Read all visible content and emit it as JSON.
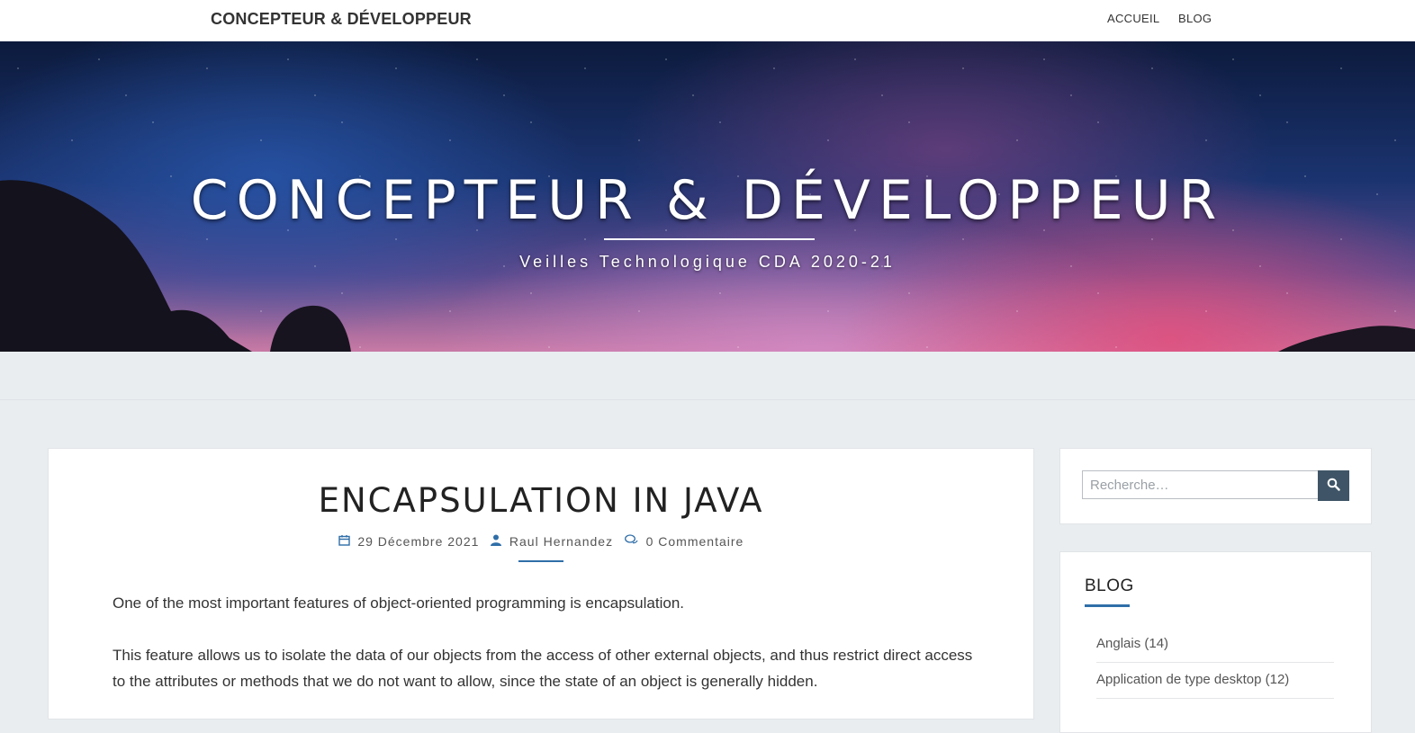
{
  "header": {
    "brand": "CONCEPTEUR & DÉVELOPPEUR",
    "nav": [
      {
        "label": "ACCUEIL"
      },
      {
        "label": "BLOG"
      }
    ]
  },
  "hero": {
    "title": "CONCEPTEUR & DÉVELOPPEUR",
    "subtitle": "Veilles Technologique CDA 2020-21"
  },
  "post": {
    "title": "ENCAPSULATION IN JAVA",
    "date": "29 Décembre 2021",
    "author": "Raul Hernandez",
    "comments": "0 Commentaire",
    "paragraphs": [
      "One of the most important features of object-oriented programming is encapsulation.",
      "This feature allows us to isolate the data of our objects from the access of other external objects, and thus restrict direct access to the attributes or methods that we do not want to allow, since the state of an object is generally hidden."
    ]
  },
  "sidebar": {
    "search": {
      "placeholder": "Recherche…"
    },
    "blog": {
      "title": "BLOG",
      "categories": [
        {
          "label": "Anglais (14)"
        },
        {
          "label": "Application de type desktop (12)"
        }
      ]
    }
  },
  "icons": {
    "date": "calendar-icon",
    "author": "user-icon",
    "comments": "comments-icon",
    "search": "search-icon"
  },
  "colors": {
    "accent": "#2f6ea8",
    "search_button": "#3f5567",
    "page_bg": "#e9edf0"
  }
}
